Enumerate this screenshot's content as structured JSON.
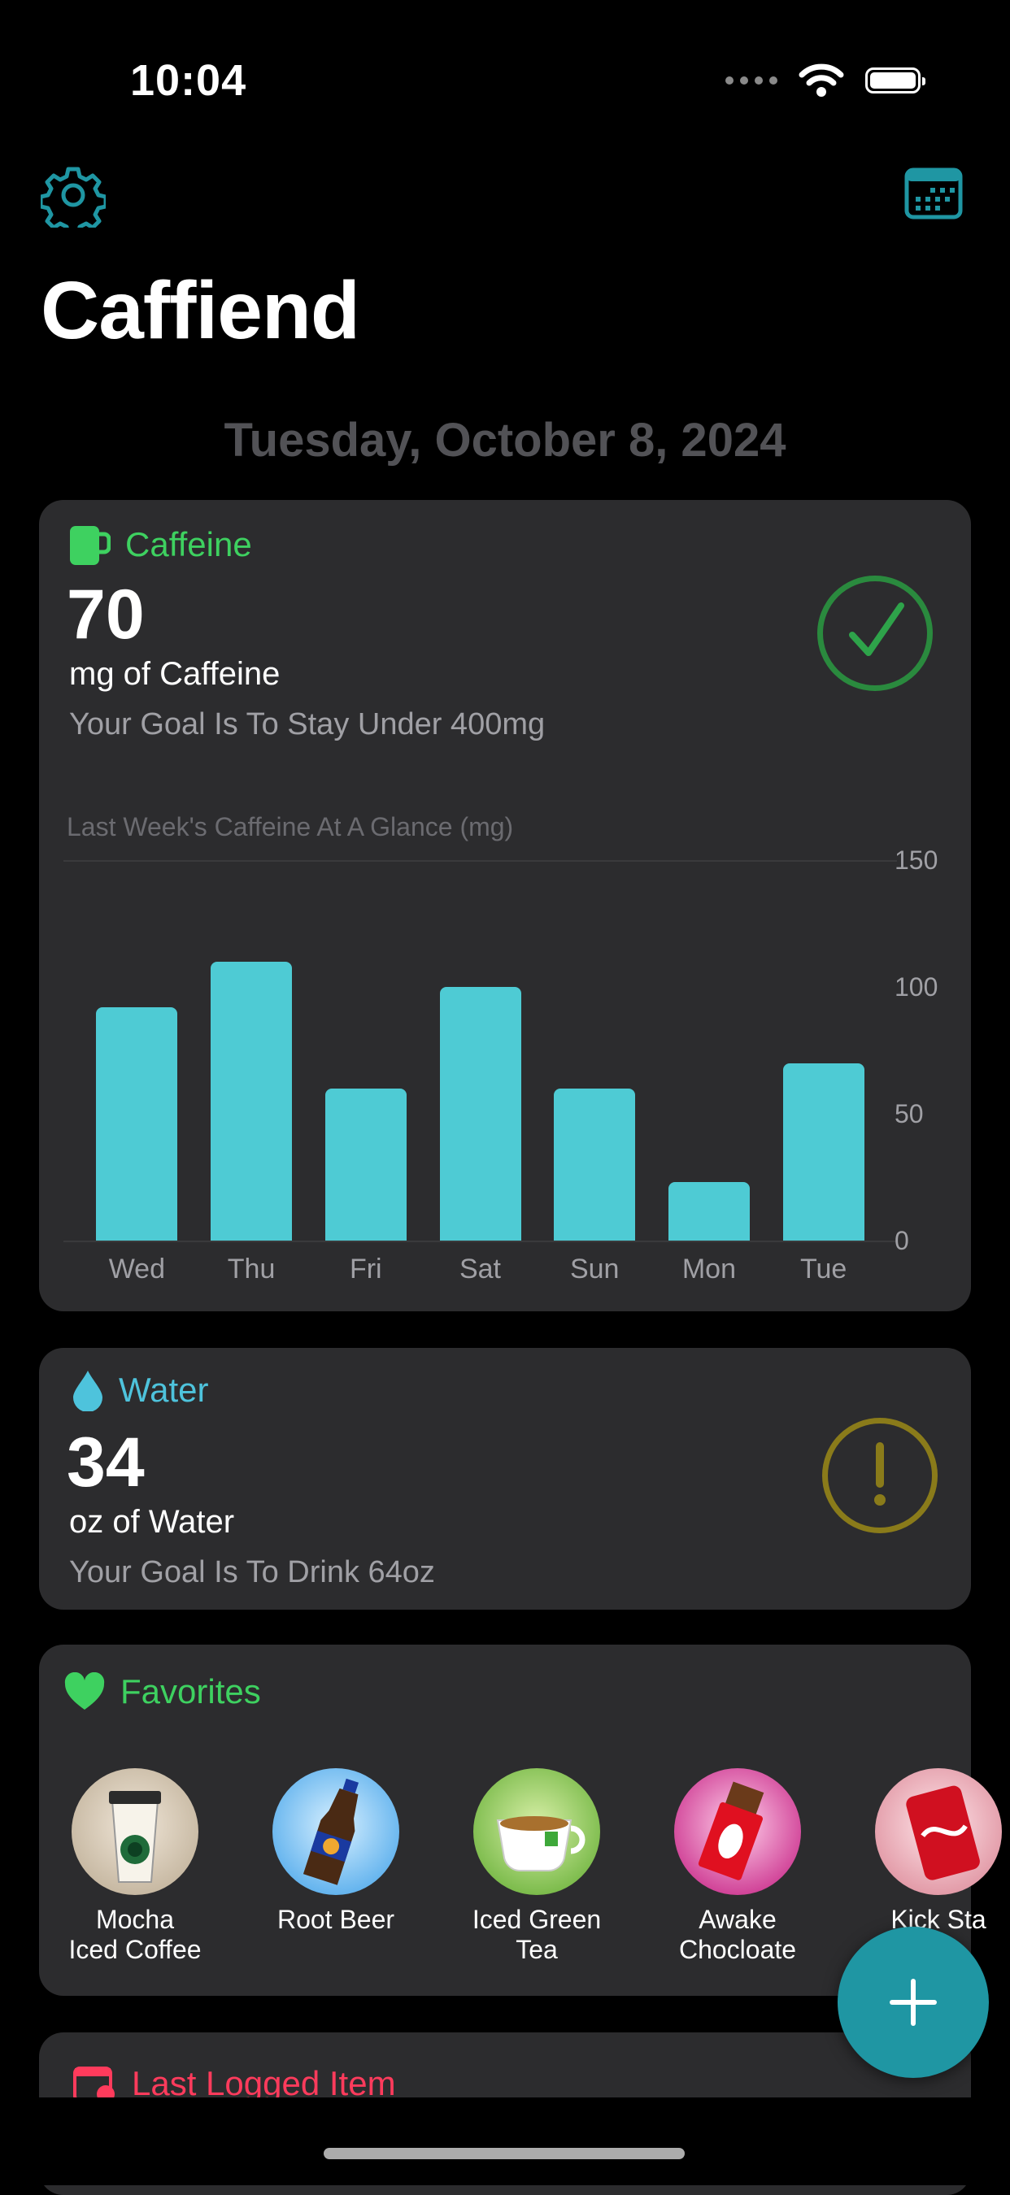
{
  "status_bar": {
    "time": "10:04"
  },
  "header": {
    "title": "Caffiend",
    "date": "Tuesday, October 8, 2024"
  },
  "icons": {
    "settings": "gear-icon",
    "calendar": "calendar-icon"
  },
  "colors": {
    "accent": "#4ecbd4",
    "caffeine": "#3ed160",
    "water": "#4ec3dc",
    "favorites": "#3ed160",
    "last_logged": "#ff3b5c",
    "ok": "#2ea34a",
    "warn": "#8a7b1a"
  },
  "caffeine": {
    "label": "Caffeine",
    "value": "70",
    "unit": "mg of Caffeine",
    "goal": "Your Goal Is To Stay Under 400mg",
    "status": "check-icon",
    "chart_title": "Last Week's Caffeine At A Glance (mg)"
  },
  "chart_data": {
    "type": "bar",
    "title": "Last Week's Caffeine At A Glance (mg)",
    "categories": [
      "Wed",
      "Thu",
      "Fri",
      "Sat",
      "Sun",
      "Mon",
      "Tue"
    ],
    "values": [
      92,
      110,
      60,
      100,
      60,
      23,
      70
    ],
    "ylim": [
      0,
      150
    ],
    "yticks": [
      "0",
      "50",
      "100",
      "150"
    ],
    "grid": true,
    "ylabel_position": "right"
  },
  "water": {
    "label": "Water",
    "value": "34",
    "unit": "oz of Water",
    "goal": "Your Goal Is To Drink 64oz",
    "status": "exclamation-icon"
  },
  "favorites": {
    "label": "Favorites",
    "items": [
      {
        "label_line1": "Mocha",
        "label_line2": "Iced Coffee"
      },
      {
        "label_line1": "Root Beer",
        "label_line2": ""
      },
      {
        "label_line1": "Iced Green",
        "label_line2": "Tea"
      },
      {
        "label_line1": "Awake",
        "label_line2": "Chocloate"
      },
      {
        "label_line1": "Kick Sta",
        "label_line2": ""
      }
    ]
  },
  "last_logged": {
    "label": "Last Logged Item"
  },
  "fab": {
    "icon": "plus-icon"
  }
}
